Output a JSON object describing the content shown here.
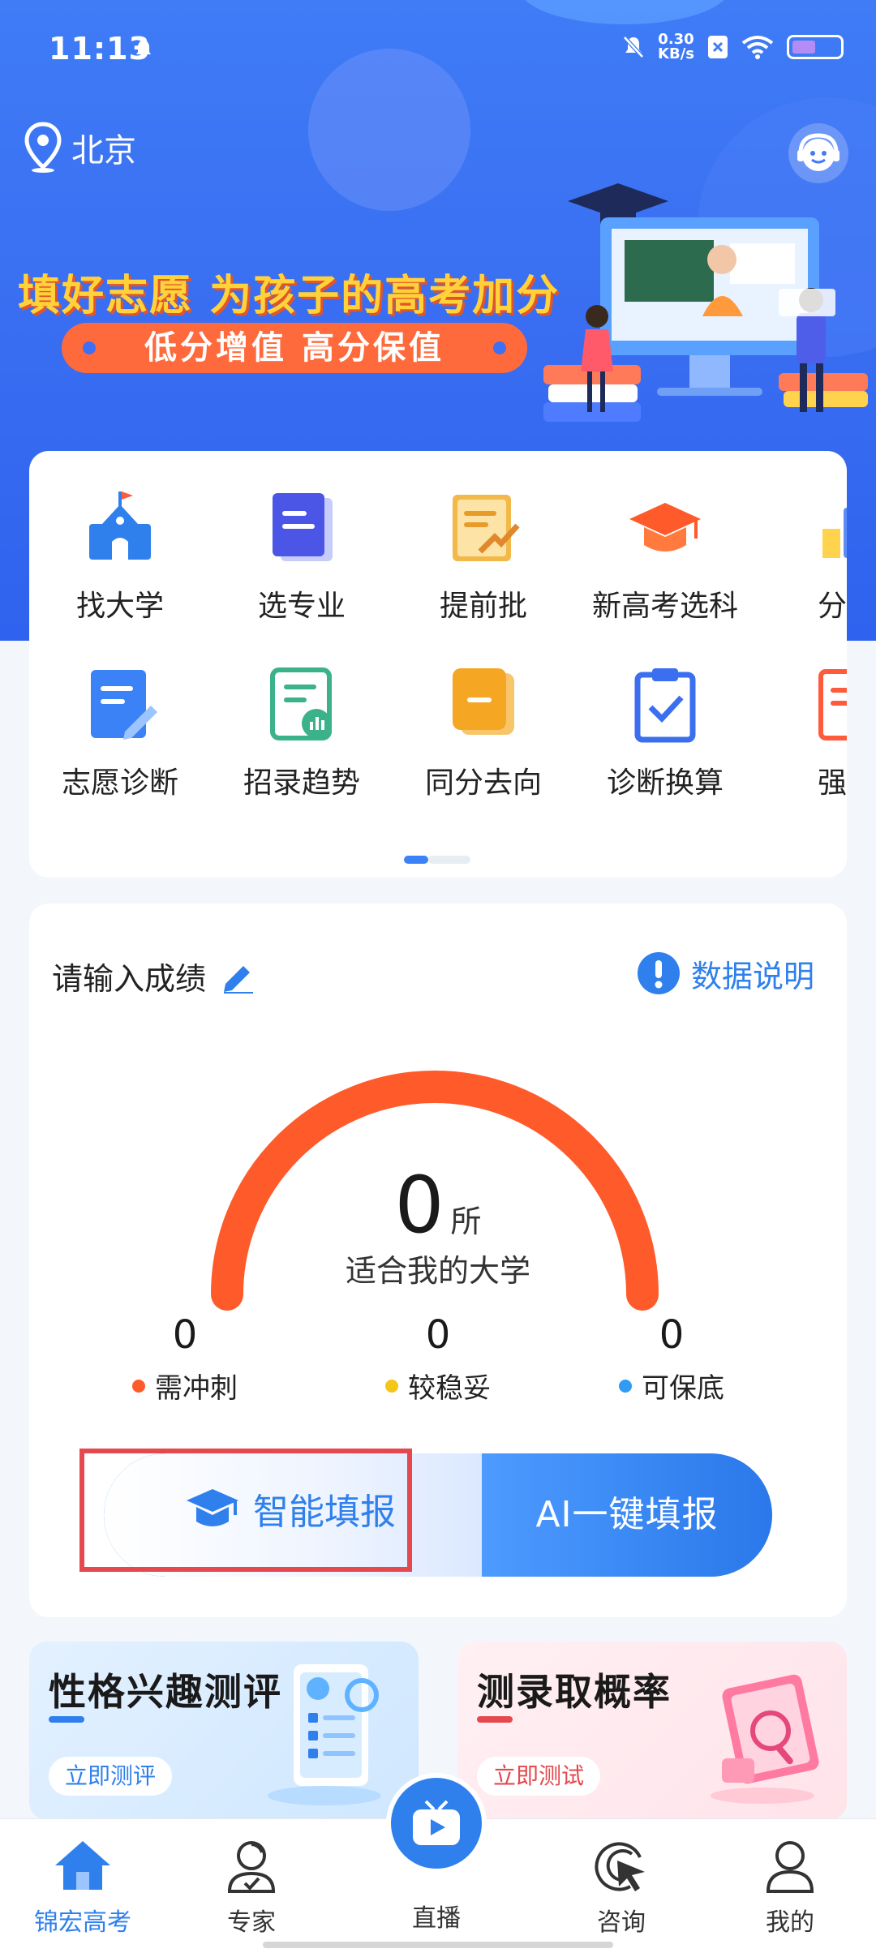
{
  "status_bar": {
    "time": "11:13",
    "net_speed_value": "0.30",
    "net_speed_unit": "KB/s"
  },
  "header": {
    "location": "北京"
  },
  "banner": {
    "title": "填好志愿  为孩子的高考加分",
    "subtitle": "低分增值  高分保值"
  },
  "features_row1": [
    {
      "label": "找大学",
      "icon": "castle-icon"
    },
    {
      "label": "选专业",
      "icon": "book-icon"
    },
    {
      "label": "提前批",
      "icon": "document-chart-icon"
    },
    {
      "label": "新高考选科",
      "icon": "graduation-cap-icon"
    },
    {
      "label": "分数",
      "icon": "chart-icon"
    }
  ],
  "features_row2": [
    {
      "label": "志愿诊断",
      "icon": "edit-document-icon"
    },
    {
      "label": "招录趋势",
      "icon": "report-icon"
    },
    {
      "label": "同分去向",
      "icon": "folder-icon"
    },
    {
      "label": "诊断换算",
      "icon": "clipboard-check-icon"
    },
    {
      "label": "强基",
      "icon": "notebook-icon"
    }
  ],
  "score": {
    "prompt": "请输入成绩",
    "data_note": "数据说明",
    "count": "0",
    "unit": "所",
    "caption": "适合我的大学",
    "stats": [
      {
        "value": "0",
        "label": "需冲刺",
        "color": "#ff5a2a"
      },
      {
        "value": "0",
        "label": "较稳妥",
        "color": "#f5c518"
      },
      {
        "value": "0",
        "label": "可保底",
        "color": "#2f9bf5"
      }
    ],
    "smart_fill": "智能填报",
    "ai_fill": "AI一键填报"
  },
  "promos": [
    {
      "title": "性格兴趣测评",
      "cta": "立即测评",
      "accent": "#2f80ed"
    },
    {
      "title": "测录取概率",
      "cta": "立即测试",
      "accent": "#e5484d"
    }
  ],
  "tabs": [
    {
      "label": "锦宏高考",
      "active": true
    },
    {
      "label": "专家",
      "active": false
    },
    {
      "label": "直播",
      "active": false
    },
    {
      "label": "咨询",
      "active": false
    },
    {
      "label": "我的",
      "active": false
    }
  ],
  "colors": {
    "brand": "#2f80ed",
    "gauge": "#ff5a2a",
    "hero": "#3a6ff2"
  }
}
